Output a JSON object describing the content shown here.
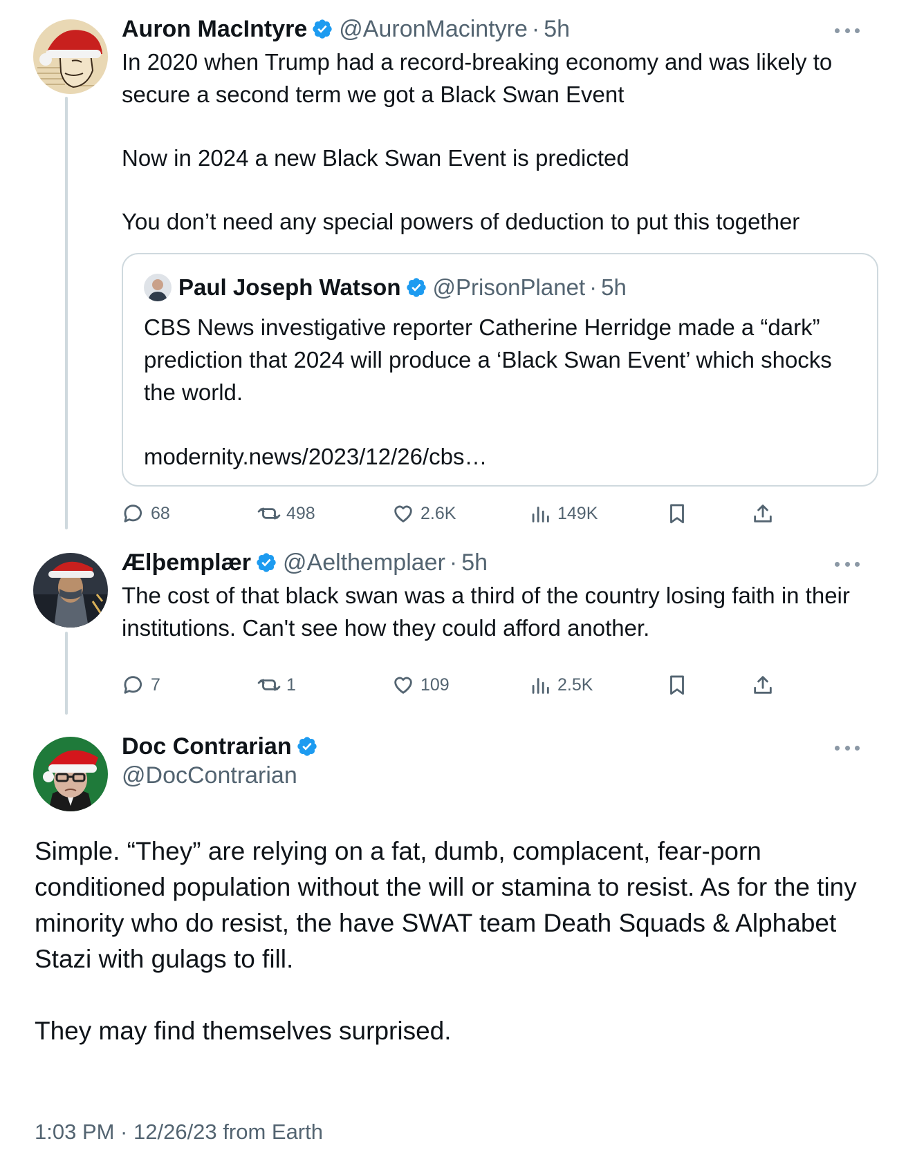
{
  "tweet1": {
    "name": "Auron MacIntyre",
    "handle": "@AuronMacintyre",
    "separator": "·",
    "time": "5h",
    "paragraphs": [
      "In 2020 when Trump had a record-breaking economy and was likely to secure a second term we got a Black Swan Event",
      "Now in 2024 a new Black Swan Event is predicted",
      "You don’t need any special powers of deduction to put this together"
    ],
    "quote": {
      "name": "Paul Joseph Watson",
      "handle": "@PrisonPlanet",
      "separator": "·",
      "time": "5h",
      "text": "CBS News investigative reporter Catherine Herridge made a “dark” prediction that 2024 will produce a ‘Black Swan Event’ which shocks the world.",
      "link": "modernity.news/2023/12/26/cbs…"
    },
    "actions": {
      "replies": "68",
      "reposts": "498",
      "likes": "2.6K",
      "views": "149K"
    }
  },
  "tweet2": {
    "name": "Ælþemplær",
    "handle": "@Aelthemplaer",
    "separator": "·",
    "time": "5h",
    "text": "The cost of that black swan was a third of the country losing faith in their institutions. Can't see how they could afford another.",
    "actions": {
      "replies": "7",
      "reposts": "1",
      "likes": "109",
      "views": "2.5K"
    }
  },
  "tweet3": {
    "name": "Doc Contrarian",
    "handle": "@DocContrarian",
    "paragraphs": [
      "Simple. “They” are relying on a fat, dumb, complacent, fear-porn conditioned population without the will or stamina to resist. As for the tiny minority who do resist, the have SWAT team Death Squads & Alphabet Stazi with gulags to fill.",
      "They may find themselves surprised."
    ],
    "meta": "1:03 PM · 12/26/23 from Earth"
  },
  "icons": {
    "verified": "verified-badge-icon",
    "reply": "reply-icon",
    "repost": "repost-icon",
    "like": "heart-icon",
    "views": "views-icon",
    "bookmark": "bookmark-icon",
    "share": "share-icon",
    "more": "more-icon"
  },
  "colors": {
    "verified": "#1d9bf0",
    "secondary_text": "#536471",
    "thread_line": "#cfd9de"
  }
}
